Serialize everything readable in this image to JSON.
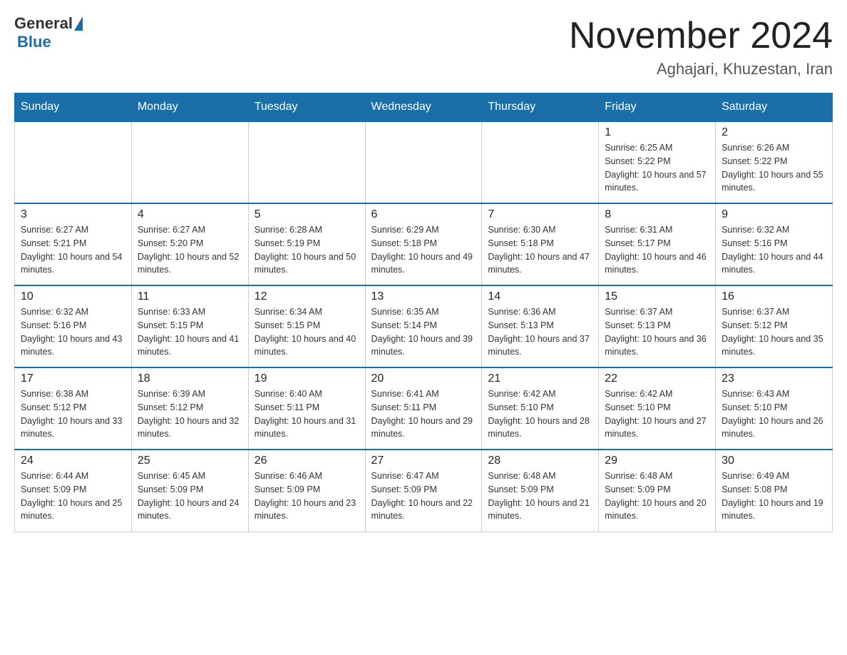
{
  "header": {
    "title": "November 2024",
    "subtitle": "Aghajari, Khuzestan, Iran"
  },
  "logo": {
    "general": "General",
    "blue": "Blue"
  },
  "days": {
    "headers": [
      "Sunday",
      "Monday",
      "Tuesday",
      "Wednesday",
      "Thursday",
      "Friday",
      "Saturday"
    ]
  },
  "weeks": [
    {
      "cells": [
        {
          "day": "",
          "info": ""
        },
        {
          "day": "",
          "info": ""
        },
        {
          "day": "",
          "info": ""
        },
        {
          "day": "",
          "info": ""
        },
        {
          "day": "",
          "info": ""
        },
        {
          "day": "1",
          "info": "Sunrise: 6:25 AM\nSunset: 5:22 PM\nDaylight: 10 hours and 57 minutes."
        },
        {
          "day": "2",
          "info": "Sunrise: 6:26 AM\nSunset: 5:22 PM\nDaylight: 10 hours and 55 minutes."
        }
      ]
    },
    {
      "cells": [
        {
          "day": "3",
          "info": "Sunrise: 6:27 AM\nSunset: 5:21 PM\nDaylight: 10 hours and 54 minutes."
        },
        {
          "day": "4",
          "info": "Sunrise: 6:27 AM\nSunset: 5:20 PM\nDaylight: 10 hours and 52 minutes."
        },
        {
          "day": "5",
          "info": "Sunrise: 6:28 AM\nSunset: 5:19 PM\nDaylight: 10 hours and 50 minutes."
        },
        {
          "day": "6",
          "info": "Sunrise: 6:29 AM\nSunset: 5:18 PM\nDaylight: 10 hours and 49 minutes."
        },
        {
          "day": "7",
          "info": "Sunrise: 6:30 AM\nSunset: 5:18 PM\nDaylight: 10 hours and 47 minutes."
        },
        {
          "day": "8",
          "info": "Sunrise: 6:31 AM\nSunset: 5:17 PM\nDaylight: 10 hours and 46 minutes."
        },
        {
          "day": "9",
          "info": "Sunrise: 6:32 AM\nSunset: 5:16 PM\nDaylight: 10 hours and 44 minutes."
        }
      ]
    },
    {
      "cells": [
        {
          "day": "10",
          "info": "Sunrise: 6:32 AM\nSunset: 5:16 PM\nDaylight: 10 hours and 43 minutes."
        },
        {
          "day": "11",
          "info": "Sunrise: 6:33 AM\nSunset: 5:15 PM\nDaylight: 10 hours and 41 minutes."
        },
        {
          "day": "12",
          "info": "Sunrise: 6:34 AM\nSunset: 5:15 PM\nDaylight: 10 hours and 40 minutes."
        },
        {
          "day": "13",
          "info": "Sunrise: 6:35 AM\nSunset: 5:14 PM\nDaylight: 10 hours and 39 minutes."
        },
        {
          "day": "14",
          "info": "Sunrise: 6:36 AM\nSunset: 5:13 PM\nDaylight: 10 hours and 37 minutes."
        },
        {
          "day": "15",
          "info": "Sunrise: 6:37 AM\nSunset: 5:13 PM\nDaylight: 10 hours and 36 minutes."
        },
        {
          "day": "16",
          "info": "Sunrise: 6:37 AM\nSunset: 5:12 PM\nDaylight: 10 hours and 35 minutes."
        }
      ]
    },
    {
      "cells": [
        {
          "day": "17",
          "info": "Sunrise: 6:38 AM\nSunset: 5:12 PM\nDaylight: 10 hours and 33 minutes."
        },
        {
          "day": "18",
          "info": "Sunrise: 6:39 AM\nSunset: 5:12 PM\nDaylight: 10 hours and 32 minutes."
        },
        {
          "day": "19",
          "info": "Sunrise: 6:40 AM\nSunset: 5:11 PM\nDaylight: 10 hours and 31 minutes."
        },
        {
          "day": "20",
          "info": "Sunrise: 6:41 AM\nSunset: 5:11 PM\nDaylight: 10 hours and 29 minutes."
        },
        {
          "day": "21",
          "info": "Sunrise: 6:42 AM\nSunset: 5:10 PM\nDaylight: 10 hours and 28 minutes."
        },
        {
          "day": "22",
          "info": "Sunrise: 6:42 AM\nSunset: 5:10 PM\nDaylight: 10 hours and 27 minutes."
        },
        {
          "day": "23",
          "info": "Sunrise: 6:43 AM\nSunset: 5:10 PM\nDaylight: 10 hours and 26 minutes."
        }
      ]
    },
    {
      "cells": [
        {
          "day": "24",
          "info": "Sunrise: 6:44 AM\nSunset: 5:09 PM\nDaylight: 10 hours and 25 minutes."
        },
        {
          "day": "25",
          "info": "Sunrise: 6:45 AM\nSunset: 5:09 PM\nDaylight: 10 hours and 24 minutes."
        },
        {
          "day": "26",
          "info": "Sunrise: 6:46 AM\nSunset: 5:09 PM\nDaylight: 10 hours and 23 minutes."
        },
        {
          "day": "27",
          "info": "Sunrise: 6:47 AM\nSunset: 5:09 PM\nDaylight: 10 hours and 22 minutes."
        },
        {
          "day": "28",
          "info": "Sunrise: 6:48 AM\nSunset: 5:09 PM\nDaylight: 10 hours and 21 minutes."
        },
        {
          "day": "29",
          "info": "Sunrise: 6:48 AM\nSunset: 5:09 PM\nDaylight: 10 hours and 20 minutes."
        },
        {
          "day": "30",
          "info": "Sunrise: 6:49 AM\nSunset: 5:08 PM\nDaylight: 10 hours and 19 minutes."
        }
      ]
    }
  ]
}
